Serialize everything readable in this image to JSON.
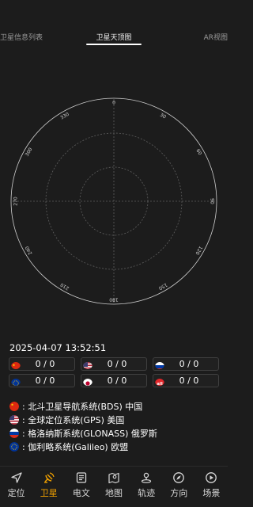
{
  "tabs": {
    "left": "卫星信息列表",
    "center": "卫星天顶图",
    "right": "AR视图"
  },
  "skyplot": {
    "azimuth_labels": [
      "0",
      "30",
      "60",
      "90",
      "120",
      "150",
      "180",
      "210",
      "240",
      "270",
      "300",
      "330"
    ]
  },
  "datetime": "2025-04-07  13:52:51",
  "counts": [
    {
      "system": "china-flag-icon",
      "value": "0 / 0"
    },
    {
      "system": "usa-flag-icon",
      "value": "0 / 0"
    },
    {
      "system": "russia-flag-icon",
      "value": "0 / 0"
    },
    {
      "system": "eu-flag-icon",
      "value": "0 / 0"
    },
    {
      "system": "japan-flag-icon",
      "value": "0 / 0"
    },
    {
      "system": "all-icon",
      "value": "0 / 0"
    }
  ],
  "all_badge": "all",
  "legend": [
    {
      "flag": "china-flag-icon",
      "label": ": 北斗卫星导航系统(BDS) 中国"
    },
    {
      "flag": "usa-flag-icon",
      "label": ": 全球定位系统(GPS) 美国"
    },
    {
      "flag": "russia-flag-icon",
      "label": ": 格洛纳斯系统(GLONASS) 俄罗斯"
    },
    {
      "flag": "eu-flag-icon",
      "label": ": 伽利略系统(Galileo) 欧盟"
    }
  ],
  "nav": [
    {
      "icon": "location-arrow-icon",
      "label": "定位"
    },
    {
      "icon": "satellite-icon",
      "label": "卫星",
      "active": true
    },
    {
      "icon": "document-icon",
      "label": "电文"
    },
    {
      "icon": "map-icon",
      "label": "地图"
    },
    {
      "icon": "track-pin-icon",
      "label": "轨迹"
    },
    {
      "icon": "compass-icon",
      "label": "方向"
    },
    {
      "icon": "play-circle-icon",
      "label": "场景"
    }
  ],
  "colors": {
    "background": "#1c1c1c",
    "active_tab": "#f0a000",
    "plot_line": "#cfcfcf",
    "grid": "#6a6a6a"
  }
}
